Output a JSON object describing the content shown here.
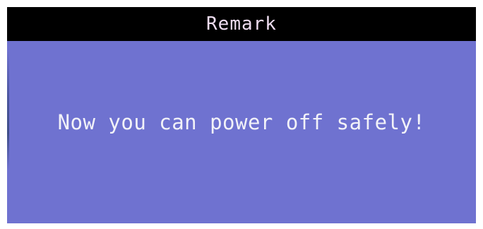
{
  "dialog": {
    "title": "Remark",
    "message": "Now you can power off safely!"
  },
  "colors": {
    "title_bar_background": "#000000",
    "title_text": "#eedcf0",
    "body_background": "#6f72d0",
    "message_text": "#f2f2f8"
  }
}
